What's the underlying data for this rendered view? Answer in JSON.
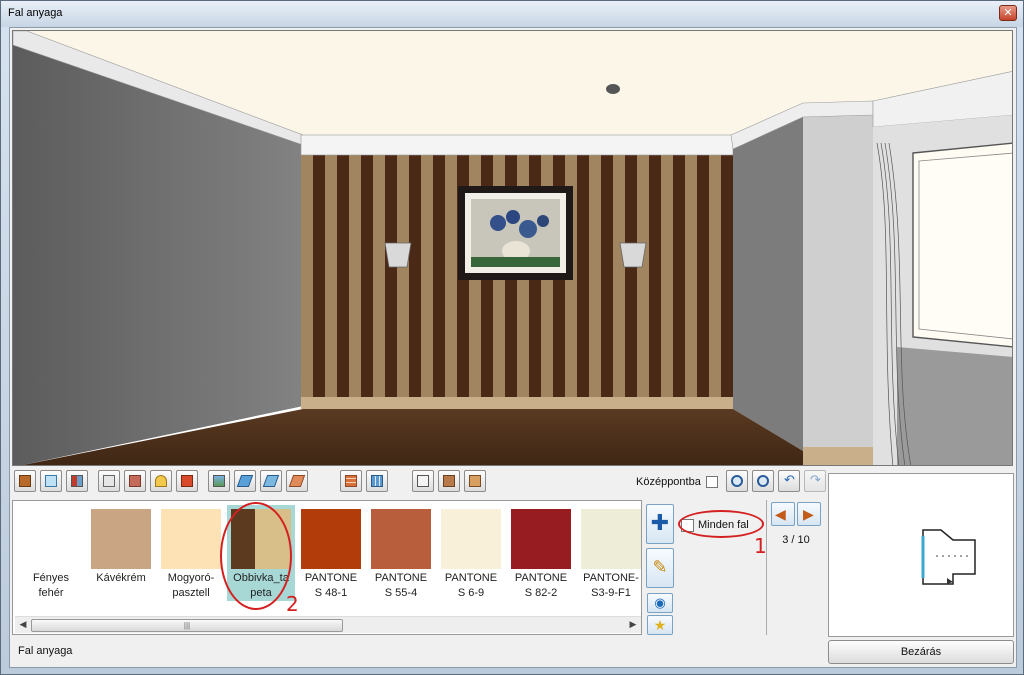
{
  "window": {
    "title": "Fal anyaga",
    "close_symbol": "✕"
  },
  "toolbar": {
    "center_label": "Középpontba",
    "center_checked": false,
    "icons": [
      "door-icon",
      "window-icon",
      "corner-window-icon",
      "wardrobe-icon",
      "sofa-icon",
      "lamp-icon",
      "wall-lamp-icon",
      "picture-icon",
      "floor-tile-icon",
      "floor-layer-icon",
      "brick-floor-icon",
      "wall-brick-icon",
      "wall-tile-icon",
      "fridge-icon",
      "chair-icon",
      "cabinet-icon",
      "zoom-in-icon",
      "zoom-out-icon",
      "undo-icon",
      "redo-icon"
    ]
  },
  "materials": {
    "items": [
      {
        "label_lines": [
          "Fényes",
          "fehér"
        ],
        "color": "#ffffff"
      },
      {
        "label_lines": [
          "Kávékrém"
        ],
        "color": "#c9a584"
      },
      {
        "label_lines": [
          "Mogyoró-",
          "pasztell"
        ],
        "color": "#fde2b6"
      },
      {
        "label_lines": [
          "Obbivka_ta",
          "peta"
        ],
        "color": "#5c3a20",
        "selected": true
      },
      {
        "label_lines": [
          "PANTONE",
          "S 48-1"
        ],
        "color": "#b23d0a"
      },
      {
        "label_lines": [
          "PANTONE",
          "S 55-4"
        ],
        "color": "#b85e3c"
      },
      {
        "label_lines": [
          "PANTONE",
          "S 6-9"
        ],
        "color": "#f8f0d8"
      },
      {
        "label_lines": [
          "PANTONE",
          "S 82-2"
        ],
        "color": "#961c22"
      },
      {
        "label_lines": [
          "PANTONE-",
          "S3-9-F1"
        ],
        "color": "#eeeed8"
      }
    ]
  },
  "side_buttons": {
    "add_icon": "plus-icon",
    "edit_icon": "pencil-icon",
    "globe_icon": "globe-icon",
    "favorite_icon": "star-icon"
  },
  "all_walls": {
    "label": "Minden fal",
    "checked": false
  },
  "pager": {
    "text": "3 / 10"
  },
  "status": {
    "text": "Fal anyaga"
  },
  "close_button": {
    "label": "Bezárás"
  },
  "annotations": {
    "marker_1": "1",
    "marker_2": "2",
    "color": "#d42020"
  }
}
